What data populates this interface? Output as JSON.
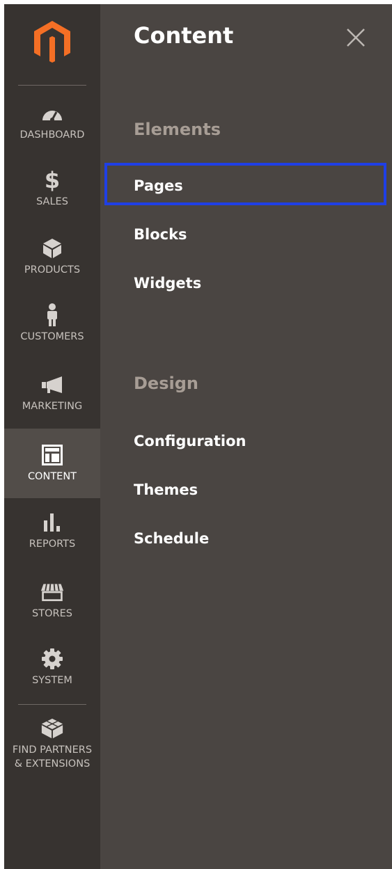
{
  "sidebar": {
    "items": [
      {
        "label": "DASHBOARD",
        "icon": "dashboard-gauge-icon"
      },
      {
        "label": "SALES",
        "icon": "dollar-icon"
      },
      {
        "label": "PRODUCTS",
        "icon": "box-icon"
      },
      {
        "label": "CUSTOMERS",
        "icon": "person-icon"
      },
      {
        "label": "MARKETING",
        "icon": "megaphone-icon"
      },
      {
        "label": "CONTENT",
        "icon": "layout-icon"
      },
      {
        "label": "REPORTS",
        "icon": "bar-chart-icon"
      },
      {
        "label": "STORES",
        "icon": "storefront-icon"
      },
      {
        "label": "SYSTEM",
        "icon": "gear-icon"
      },
      {
        "label": "FIND PARTNERS\n& EXTENSIONS",
        "icon": "extension-cubes-icon"
      }
    ],
    "active": "CONTENT",
    "brand_color": "#f46f25"
  },
  "panel": {
    "title": "Content",
    "sections": [
      {
        "title": "Elements",
        "links": [
          "Pages",
          "Blocks",
          "Widgets"
        ]
      },
      {
        "title": "Design",
        "links": [
          "Configuration",
          "Themes",
          "Schedule"
        ]
      }
    ],
    "highlighted_link": "Pages",
    "highlight_color": "#1f3fe6"
  }
}
